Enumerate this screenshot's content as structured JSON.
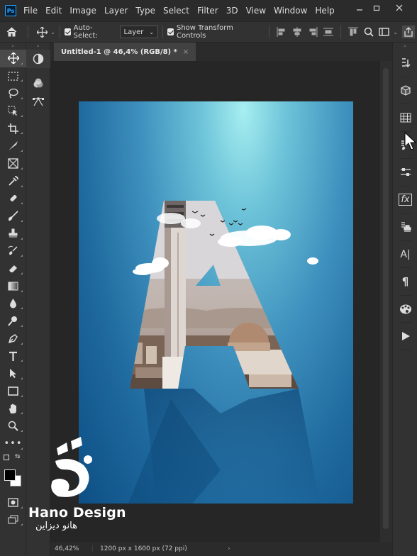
{
  "app": {
    "logo_text": "Ps"
  },
  "menu": [
    "File",
    "Edit",
    "Image",
    "Layer",
    "Type",
    "Select",
    "Filter",
    "3D",
    "View",
    "Window",
    "Help"
  ],
  "window_controls": [
    "minimize-icon",
    "restore-icon",
    "close-icon"
  ],
  "options_bar": {
    "auto_select_label": "Auto-Select:",
    "auto_select_checked": true,
    "auto_select_target": "Layer",
    "show_transform_label": "Show Transform Controls",
    "show_transform_checked": true
  },
  "document": {
    "tab_title": "Untitled-1 @ 46,4% (RGB/8) *",
    "zoom": "46,42%",
    "info": "1200 px x 1600 px (72 ppi)",
    "info_arrow": "›"
  },
  "left_tools": [
    "move-icon",
    "marquee-icon",
    "lasso-icon",
    "object-select-icon",
    "crop-icon",
    "slice-icon",
    "frame-icon",
    "eyedropper-icon",
    "healing-brush-icon",
    "brush-icon",
    "stamp-icon",
    "history-brush-icon",
    "eraser-icon",
    "gradient-icon",
    "blur-icon",
    "dodge-icon",
    "pen-icon",
    "type-icon",
    "path-select-icon",
    "rectangle-icon",
    "hand-icon",
    "zoom-icon",
    "more-tools-icon"
  ],
  "right_panels": [
    "history-icon",
    "3d-icon",
    "swatches-icon",
    "brushes-icon",
    "adjustments-icon",
    "fx-icon",
    "libraries-icon",
    "character-icon",
    "paragraph-icon",
    "color-icon",
    "actions-icon"
  ],
  "canvas_text": {
    "character_label": "A|",
    "paragraph_label": "¶",
    "fx_label": "fx"
  },
  "watermark": {
    "name": "Hano Design",
    "arabic_name": "هانو ديزاين",
    "accent_color": "#ffffff"
  },
  "colors": {
    "canvas_top": "#a6eef1",
    "canvas_bottom": "#0d4f85",
    "menubar": "#2b2b2b",
    "panel": "#323232"
  }
}
